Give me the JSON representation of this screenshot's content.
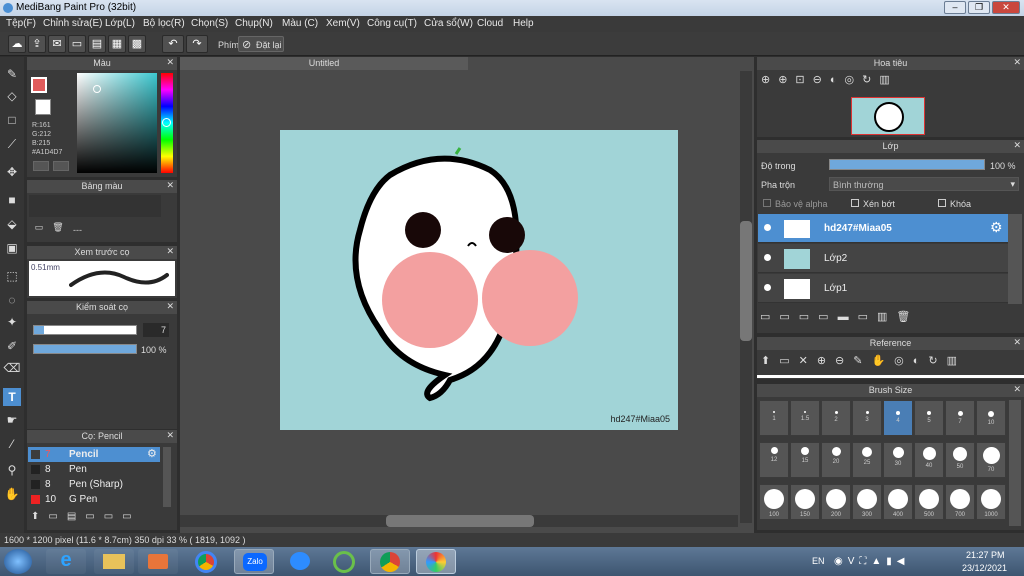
{
  "app": {
    "title": "MediBang Paint Pro (32bit)"
  },
  "menu": [
    "Tệp(F)",
    "Chỉnh sửa(E)",
    "Lớp(L)",
    "Bộ lọc(R)",
    "Chọn(S)",
    "Chụp(N)",
    "Màu (C)",
    "Xem(V)",
    "Công cụ(T)",
    "Cửa sổ(W)",
    "Cloud",
    "Help"
  ],
  "toolbar": {
    "key_label": "Phím",
    "reset_label": "Đặt lại"
  },
  "color_panel": {
    "title": "Màu",
    "r": "R:161",
    "g": "G:212",
    "b": "B:215",
    "hex": "#A1D4D7"
  },
  "palette_panel": {
    "title": "Bảng màu",
    "dash": "---"
  },
  "brush_preview": {
    "title": "Xem trước cọ",
    "size": "0.51mm"
  },
  "control_panel": {
    "title": "Kiểm soát cọ",
    "size_value": "7",
    "opacity_value": "100 %"
  },
  "brush_panel": {
    "title": "Cọ: Pencil",
    "items": [
      {
        "num": "7",
        "name": "Pencil"
      },
      {
        "num": "8",
        "name": "Pen"
      },
      {
        "num": "8",
        "name": "Pen (Sharp)"
      },
      {
        "num": "10",
        "name": "G Pen"
      }
    ]
  },
  "canvas": {
    "tab": "Untitled",
    "watermark": "hd247#Miaa05"
  },
  "navigator": {
    "title": "Hoa tiêu"
  },
  "layers_panel": {
    "title": "Lớp",
    "opacity_label": "Độ trong",
    "opacity_value": "100 %",
    "blend_label": "Pha trộn",
    "blend_value": "Bình thường",
    "protect_alpha": "Bảo vệ alpha",
    "clipping": "Xén bớt",
    "lock": "Khóa",
    "layers": [
      "hd247#Miaa05",
      "Lớp2",
      "Lớp1"
    ]
  },
  "reference_panel": {
    "title": "Reference"
  },
  "brush_size_panel": {
    "title": "Brush Size",
    "sizes": [
      "1",
      "1.5",
      "2",
      "3",
      "4",
      "5",
      "7",
      "10",
      "12",
      "15",
      "20",
      "25",
      "30",
      "40",
      "50",
      "70",
      "100",
      "150",
      "200",
      "300",
      "400",
      "500",
      "700",
      "1000"
    ]
  },
  "status": {
    "text": "1600 * 1200 pixel   (11.6 * 8.7cm)   350 dpi   33 %   ( 1819, 1092 )"
  },
  "taskbar": {
    "lang": "EN",
    "time": "21:27 PM",
    "date": "23/12/2021",
    "zalo": "Zalo"
  }
}
